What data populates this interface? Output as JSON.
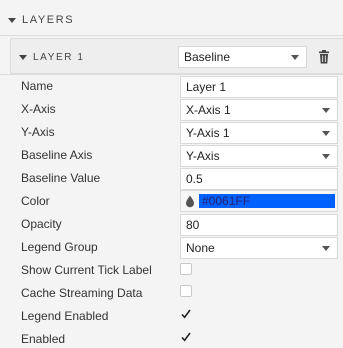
{
  "section": {
    "title": "LAYERS"
  },
  "layer": {
    "title": "LAYER 1",
    "type_selected": "Baseline"
  },
  "fields": {
    "name": {
      "label": "Name",
      "value": "Layer 1"
    },
    "x_axis": {
      "label": "X-Axis",
      "value": "X-Axis 1"
    },
    "y_axis": {
      "label": "Y-Axis",
      "value": "Y-Axis 1"
    },
    "baseline_axis": {
      "label": "Baseline Axis",
      "value": "Y-Axis"
    },
    "baseline_value": {
      "label": "Baseline Value",
      "value": "0.5"
    },
    "color": {
      "label": "Color",
      "value": "#0061FF",
      "swatch": "#0061ff",
      "icon": "droplet-icon"
    },
    "opacity": {
      "label": "Opacity",
      "value": "80"
    },
    "legend_group": {
      "label": "Legend Group",
      "value": "None"
    },
    "show_current_tick_label": {
      "label": "Show Current Tick Label",
      "checked": false
    },
    "cache_streaming_data": {
      "label": "Cache Streaming Data",
      "checked": false
    },
    "legend_enabled": {
      "label": "Legend Enabled",
      "checked": true
    },
    "enabled": {
      "label": "Enabled",
      "checked": true
    }
  },
  "icons": {
    "delete": "trash-icon",
    "collapse": "triangle-down-icon"
  }
}
